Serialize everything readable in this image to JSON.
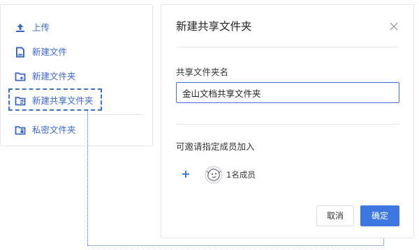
{
  "menu": {
    "items": [
      {
        "label": "上传",
        "icon": "upload-icon"
      },
      {
        "label": "新建文件",
        "icon": "new-file-icon"
      },
      {
        "label": "新建文件夹",
        "icon": "new-folder-icon"
      },
      {
        "label": "新建共享文件夹",
        "icon": "new-shared-folder-icon"
      },
      {
        "label": "私密文件夹",
        "icon": "private-folder-icon"
      }
    ]
  },
  "dialog": {
    "title": "新建共享文件夹",
    "name_label": "共享文件夹名",
    "name_value": "金山文档共享文件夹",
    "invite_label": "可邀请指定成员加入",
    "member_count": "1名成员",
    "cancel_label": "取消",
    "ok_label": "确定"
  },
  "colors": {
    "accent": "#3c78e0",
    "menu_text": "#3a67c7",
    "highlight": "#3c6fcf"
  }
}
